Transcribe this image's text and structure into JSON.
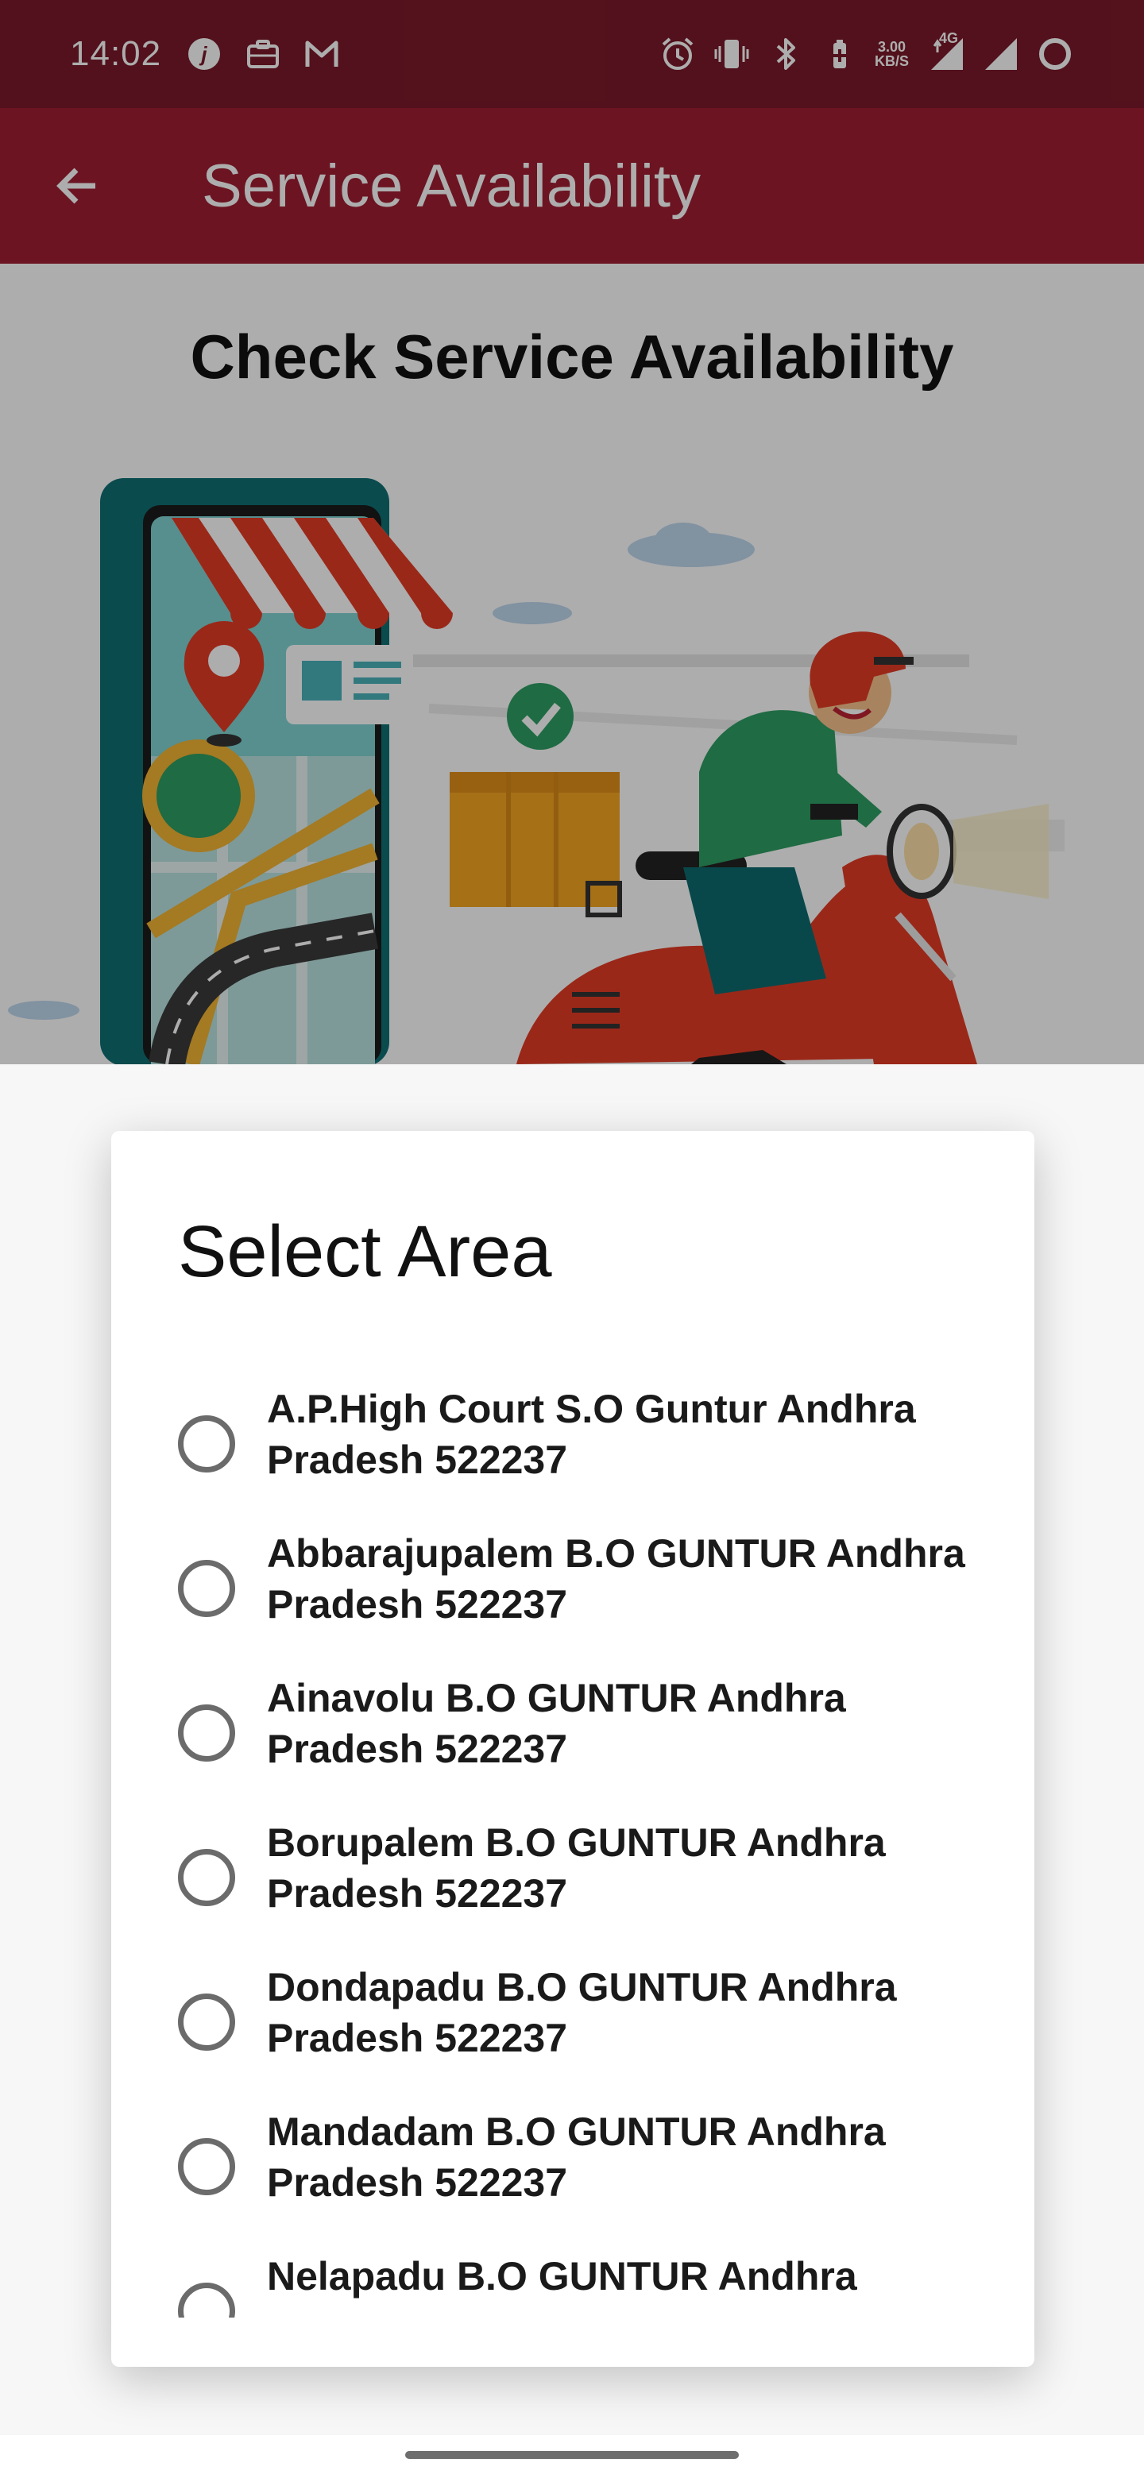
{
  "status_bar": {
    "time": "14:02",
    "net_speed_value": "3.00",
    "net_speed_unit": "KB/S",
    "network_type": "4G",
    "left_icons": [
      "jio-icon",
      "briefcase-icon",
      "gmail-icon"
    ],
    "right_icons": [
      "alarm-icon",
      "vibrate-icon",
      "bluetooth-icon",
      "battery-saver-icon",
      "signal-icon",
      "signal-icon",
      "battery-ring-icon"
    ]
  },
  "app_bar": {
    "title": "Service Availability",
    "back_icon": "arrow-left-icon"
  },
  "content": {
    "heading": "Check Service Availability"
  },
  "dialog": {
    "title": "Select Area",
    "options": [
      {
        "label": "A.P.High Court S.O Guntur Andhra Pradesh 522237",
        "selected": false
      },
      {
        "label": "Abbarajupalem B.O GUNTUR Andhra Pradesh 522237",
        "selected": false
      },
      {
        "label": "Ainavolu B.O GUNTUR Andhra Pradesh 522237",
        "selected": false
      },
      {
        "label": "Borupalem B.O GUNTUR Andhra Pradesh 522237",
        "selected": false
      },
      {
        "label": "Dondapadu B.O GUNTUR Andhra Pradesh 522237",
        "selected": false
      },
      {
        "label": "Mandadam B.O GUNTUR Andhra Pradesh 522237",
        "selected": false
      },
      {
        "label": "Nelapadu B.O GUNTUR Andhra",
        "selected": false
      }
    ]
  },
  "colors": {
    "status_bar": "#7a1a2a",
    "app_bar": "#a01e33",
    "radio_border": "#6b6b6b"
  }
}
